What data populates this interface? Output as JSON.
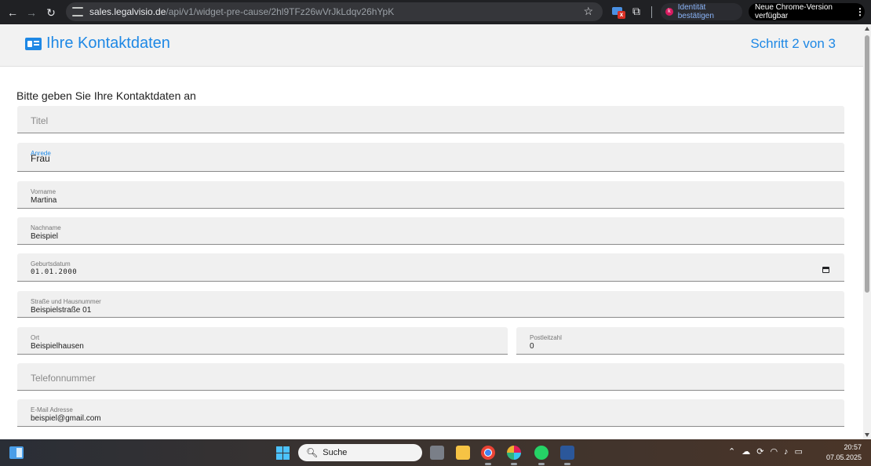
{
  "browser": {
    "url_host": "sales.legalvisio.de",
    "url_path": "/api/v1/widget-pre-cause/2hl9TFz26wVrJkLdqv26hYpK",
    "identity_label": "Identität bestätigen",
    "identity_avatar": "k",
    "update_label": "Neue Chrome-Version verfügbar",
    "ext_badge": "x"
  },
  "header": {
    "title": "Ihre Kontaktdaten",
    "step": "Schritt 2 von 3"
  },
  "intro": "Bitte geben Sie Ihre Kontaktdaten an",
  "fields": {
    "titel": {
      "placeholder": "Titel"
    },
    "anrede": {
      "label": "Anrede",
      "value": "Frau"
    },
    "vorname": {
      "label": "Vorname",
      "value": "Martina"
    },
    "nachname": {
      "label": "Nachname",
      "value": "Beispiel"
    },
    "geburtsdatum": {
      "label": "Geburtsdatum",
      "value": "01.01.2000"
    },
    "strasse": {
      "label": "Straße und Hausnummer",
      "value": "Beispielstraße 01"
    },
    "ort": {
      "label": "Ort",
      "value": "Beispielhausen"
    },
    "plz": {
      "label": "Postleitzahl",
      "value": "0"
    },
    "telefon": {
      "placeholder": "Telefonnummer"
    },
    "email": {
      "label": "E-Mail Adresse",
      "value": "beispiel@gmail.com"
    }
  },
  "taskbar": {
    "search_label": "Suche",
    "time": "20:57",
    "date": "07.05.2025",
    "apps": [
      "file-explorer-icon",
      "chrome-icon",
      "slack-icon",
      "whatsapp-icon",
      "word-icon"
    ]
  },
  "colors": {
    "accent": "#1e88e5",
    "field_bg": "#f0f0f0",
    "header_bg": "#f2f2f2"
  }
}
